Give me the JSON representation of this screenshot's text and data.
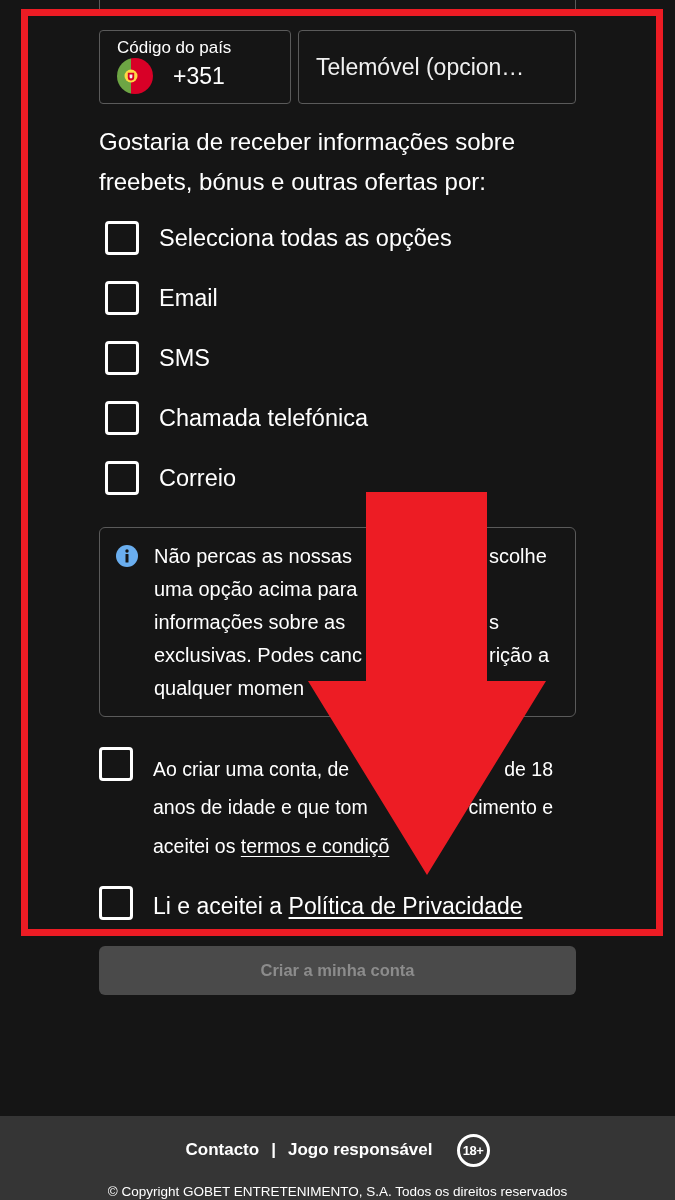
{
  "phone": {
    "country_code": {
      "label": "Código do país",
      "value": "+351"
    },
    "number": {
      "placeholder": "Telemóvel (opcion…"
    }
  },
  "marketing": {
    "question": "Gostaria de receber informações sobre freebets, bónus e outras ofertas por:",
    "options": [
      {
        "label": "Selecciona todas as opções",
        "checked": false
      },
      {
        "label": "Email",
        "checked": false
      },
      {
        "label": "SMS",
        "checked": false
      },
      {
        "label": "Chamada telefónica",
        "checked": false
      },
      {
        "label": "Correio",
        "checked": false
      }
    ]
  },
  "info_note": {
    "lines": [
      {
        "text": "Não percas as nossas",
        "after_arrow": "scolhe"
      },
      {
        "text": "uma opção acima para"
      },
      {
        "text": "informações sobre as",
        "after_arrow": "s"
      },
      {
        "text": "exclusivas. Podes canc",
        "after_arrow": "rição a"
      },
      {
        "text": "qualquer momen"
      }
    ]
  },
  "agreements": [
    {
      "kind": "paragraph",
      "checked": false,
      "lines": [
        {
          "text": "Ao criar uma conta, de",
          "after_arrow": "de 18"
        },
        {
          "text": "anos de idade e que tom",
          "after_arrow": "cimento e"
        },
        {
          "text": "aceitei os",
          "link": "termos e condiçõ"
        }
      ]
    },
    {
      "kind": "line",
      "checked": false,
      "lines": [
        {
          "text": "Li e aceitei a",
          "link": "Política de Privacidade"
        }
      ]
    }
  ],
  "submit_button": {
    "label": "Criar a minha conta",
    "disabled": true
  },
  "footer": {
    "links": [
      {
        "label": "Contacto"
      },
      {
        "label": "Jogo responsável"
      }
    ],
    "separator": "|",
    "age_badge": "18+",
    "copyright": "© Copyright GOBET ENTRETENIMENTO, S.A. Todos os direitos reservados"
  }
}
